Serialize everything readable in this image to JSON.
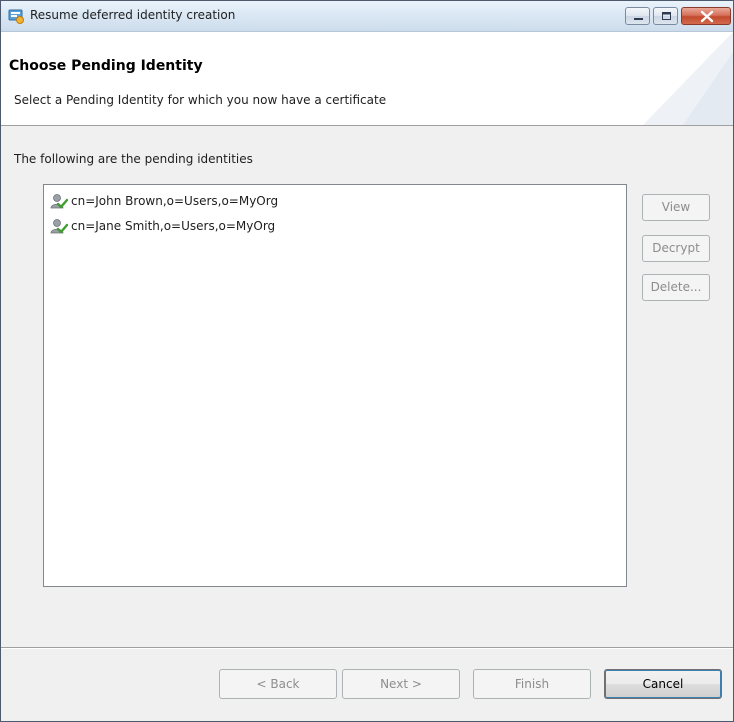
{
  "window": {
    "title": "Resume deferred identity creation",
    "accent_color": "#3c7fb1",
    "close_button_color": "#c24a2e"
  },
  "header": {
    "title": "Choose Pending Identity",
    "subtitle": "Select a Pending Identity for which you now have a certificate"
  },
  "main": {
    "section_label": "The following are the pending identities",
    "identities": [
      {
        "label": "cn=John Brown,o=Users,o=MyOrg",
        "icon": "user-certificate-icon"
      },
      {
        "label": "cn=Jane Smith,o=Users,o=MyOrg",
        "icon": "user-certificate-icon"
      }
    ],
    "side_buttons": {
      "view": "View",
      "decrypt": "Decrypt",
      "delete": "Delete..."
    }
  },
  "footer": {
    "back": "< Back",
    "next": "Next >",
    "finish": "Finish",
    "cancel": "Cancel"
  }
}
